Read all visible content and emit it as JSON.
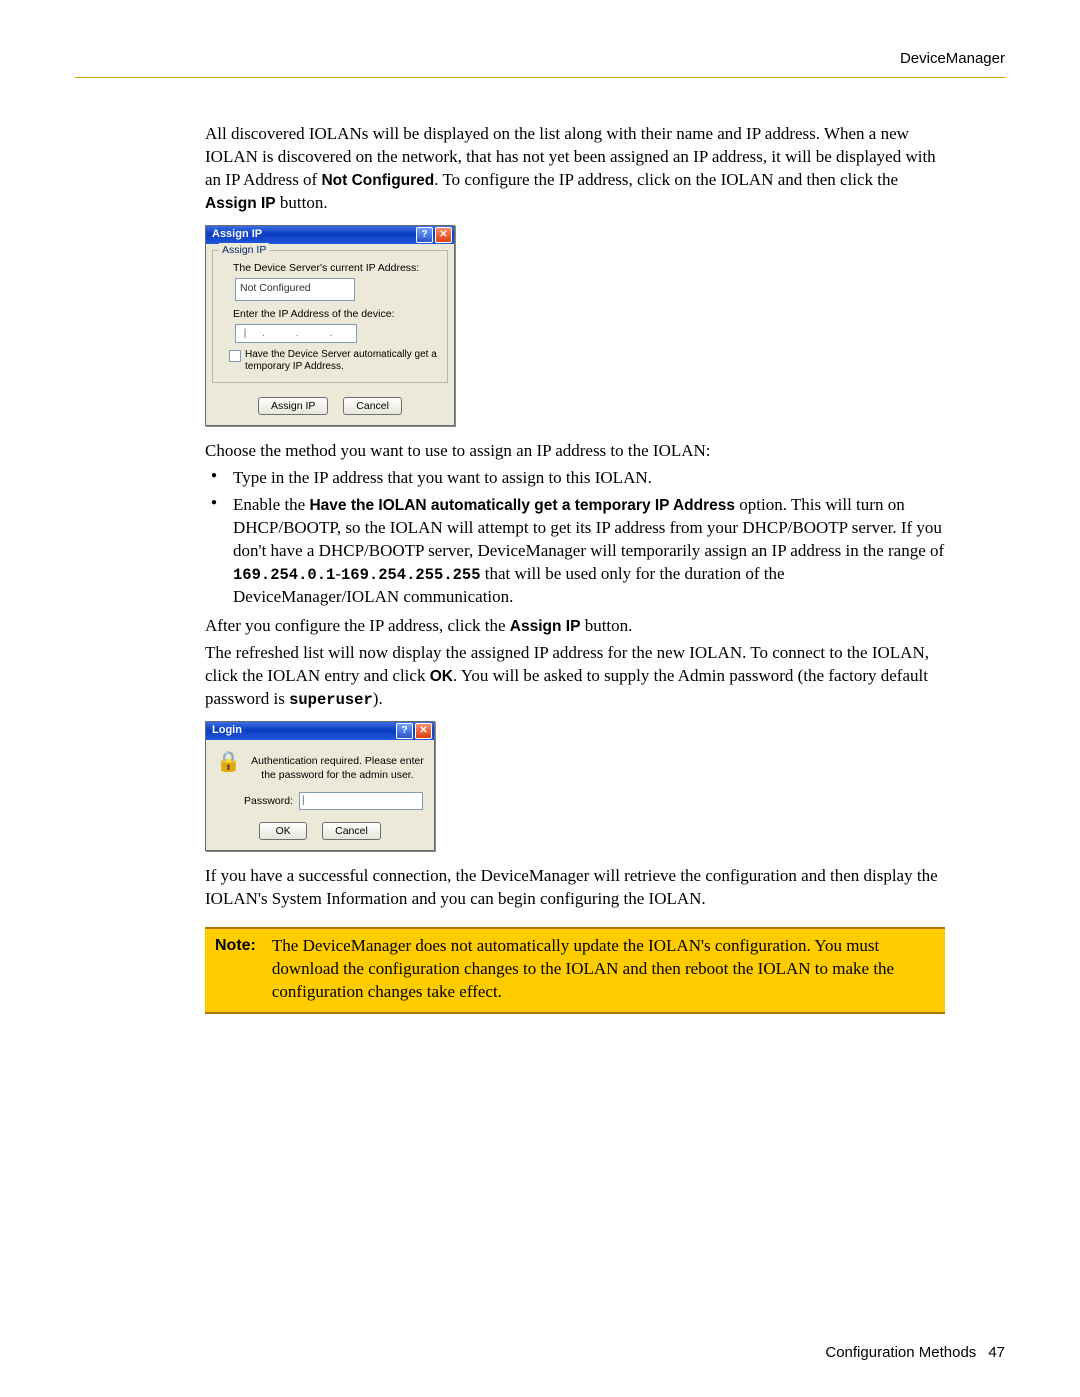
{
  "header": {
    "right": "DeviceManager"
  },
  "p1": {
    "t1": "All discovered IOLANs will be displayed on the list along with their name and IP address. When a new IOLAN is discovered on the network, that has not yet been assigned an IP address, it will be displayed with an IP Address of ",
    "b1": "Not Configured",
    "t2": ". To configure the IP address, click on the IOLAN and then click the ",
    "b2": "Assign IP",
    "t3": " button."
  },
  "dlg1": {
    "title": "Assign IP",
    "legend": "Assign IP",
    "lbl_current": "The Device Server's current IP Address:",
    "val_notconf": "Not Configured",
    "lbl_enter": "Enter the IP Address of the device:",
    "ip_sep": ".",
    "chk_text": "Have the Device Server automatically get a temporary IP Address.",
    "btn_assign": "Assign IP",
    "btn_cancel": "Cancel"
  },
  "p2": "Choose the method you want to use to assign an IP address to the IOLAN:",
  "b1": "Type in the IP address that you want to assign to this IOLAN.",
  "b2": {
    "t1": "Enable the ",
    "b1": "Have the IOLAN automatically get a temporary IP Address",
    "t2": " option. This will turn on DHCP/BOOTP, so the IOLAN will attempt to get its IP address from your DHCP/BOOTP server. If you don't have a DHCP/BOOTP server, DeviceManager will temporarily assign an IP address in the range of ",
    "m1": "169.254.0.1",
    "t3": "-",
    "m2": "169.254.255.255",
    "t4": " that will be used only for the duration of the DeviceManager/IOLAN communication."
  },
  "p3": {
    "t1": "After you configure the IP address, click the ",
    "b1": "Assign IP",
    "t2": " button."
  },
  "p4": {
    "t1": "The refreshed list will now display the assigned IP address for the new IOLAN. To connect to the IOLAN, click the IOLAN entry and click ",
    "b1": "OK",
    "t2": ". You will be asked to supply the Admin password (the factory default password is ",
    "m1": "superuser",
    "t3": ")."
  },
  "dlg2": {
    "title": "Login",
    "msg": "Authentication required. Please enter the password for the admin user.",
    "lbl_pw": "Password:",
    "btn_ok": "OK",
    "btn_cancel": "Cancel"
  },
  "p5": "If you have a successful connection, the DeviceManager will retrieve the configuration and then display the IOLAN's System Information and you can begin configuring the IOLAN.",
  "note": {
    "label": "Note:",
    "text": "The DeviceManager does not automatically update the IOLAN's configuration. You must download the configuration changes to the IOLAN and then reboot the IOLAN to make the configuration changes take effect."
  },
  "footer": {
    "section": "Configuration Methods",
    "page": "47"
  }
}
